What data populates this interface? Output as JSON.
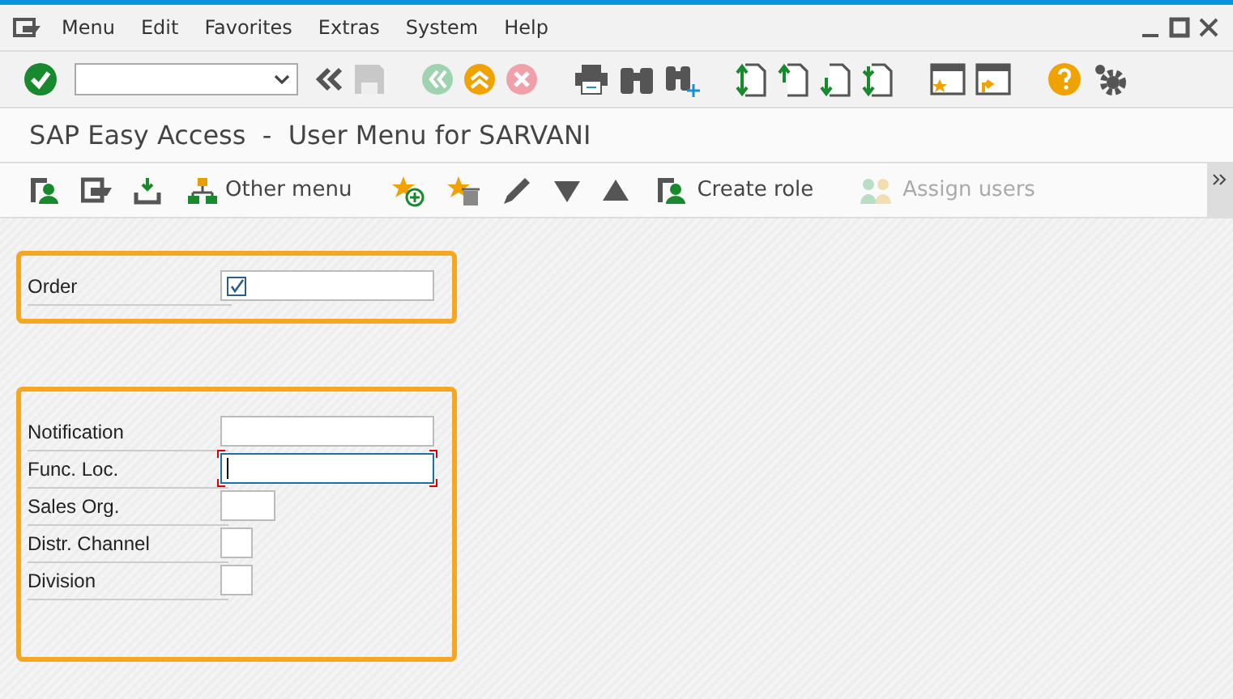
{
  "menu_bar": {
    "items": [
      "Menu",
      "Edit",
      "Favorites",
      "Extras",
      "System",
      "Help"
    ]
  },
  "title": "SAP Easy Access  -  User Menu for SARVANI",
  "app_toolbar": [
    {
      "label": "Other menu",
      "disabled": false
    },
    {
      "label": "Create role",
      "disabled": false
    },
    {
      "label": "Assign users",
      "disabled": true
    }
  ],
  "groups": [
    {
      "fields": [
        {
          "label": "Order",
          "kind": "checkbox",
          "checked": true
        }
      ]
    },
    {
      "fields": [
        {
          "label": "Notification",
          "kind": "text",
          "focused": false
        },
        {
          "label": "Func. Loc.",
          "kind": "text",
          "focused": true
        },
        {
          "label": "Sales Org.",
          "kind": "text",
          "focused": false
        },
        {
          "label": "Distr. Channel",
          "kind": "text",
          "focused": false
        },
        {
          "label": "Division",
          "kind": "text",
          "focused": false
        }
      ]
    }
  ]
}
